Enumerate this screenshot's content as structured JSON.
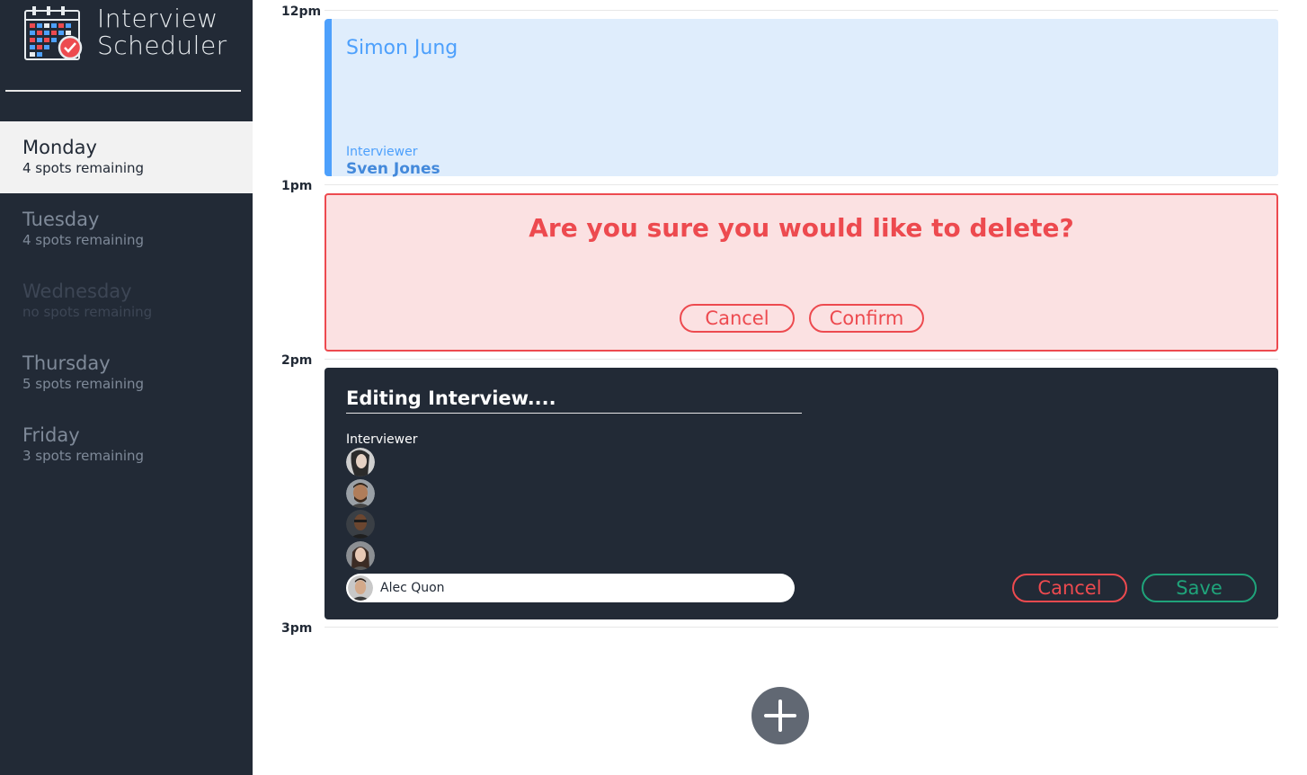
{
  "app": {
    "title_line1": "Interview",
    "title_line2": "Scheduler"
  },
  "sidebar": {
    "days": [
      {
        "name": "Monday",
        "spots": "4 spots remaining",
        "state": "selected"
      },
      {
        "name": "Tuesday",
        "spots": "4 spots remaining",
        "state": "normal"
      },
      {
        "name": "Wednesday",
        "spots": "no spots remaining",
        "state": "full"
      },
      {
        "name": "Thursday",
        "spots": "5 spots remaining",
        "state": "normal"
      },
      {
        "name": "Friday",
        "spots": "3 spots remaining",
        "state": "normal"
      }
    ]
  },
  "schedule": {
    "hours": [
      "12pm",
      "1pm",
      "2pm",
      "3pm"
    ],
    "show": {
      "student": "Simon Jung",
      "interviewer_label": "Interviewer",
      "interviewer": "Sven Jones"
    },
    "confirm": {
      "message": "Are you sure you would like to delete?",
      "cancel_label": "Cancel",
      "confirm_label": "Confirm"
    },
    "edit": {
      "title": "Editing Interview....",
      "interviewer_label": "Interviewer",
      "selected_interviewer": "Alec Quon",
      "cancel_label": "Cancel",
      "save_label": "Save"
    }
  },
  "colors": {
    "sidebar_bg": "#222a36",
    "accent_blue": "#4da0fc",
    "danger": "#ed4a4f",
    "success": "#1fa37a"
  }
}
